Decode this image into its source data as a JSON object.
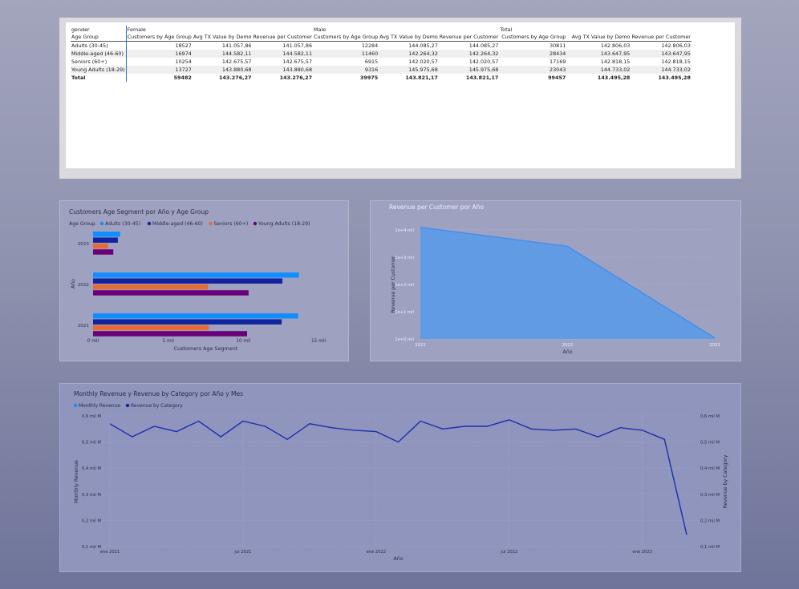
{
  "table": {
    "header_row1": {
      "col_label": "gender",
      "female": "Female",
      "male": "Male",
      "total": "Total"
    },
    "header_row2": {
      "row_label": "Age Group",
      "c1": "Customers by Age Group",
      "c2": "Avg TX Value by Demo",
      "c3": "Revenue per Customer",
      "c4": "Customers by Age Group",
      "c5": "Avg TX Value by Demo",
      "c6": "Revenue per Customer",
      "c7": "Customers by Age Group",
      "c8": "Avg TX Value by Demo",
      "c9": "Revenue per Customer"
    },
    "rows": [
      {
        "group": "Adults (30-45)",
        "v": [
          "18527",
          "141.057,86",
          "141.057,86",
          "12284",
          "144.085,27",
          "144.085,27",
          "30811",
          "142.806,03",
          "142.806,03"
        ]
      },
      {
        "group": "Middle-aged (46-60)",
        "v": [
          "16974",
          "144.582,11",
          "144.582,11",
          "11460",
          "142.264,32",
          "142.264,32",
          "28434",
          "143.647,95",
          "143.647,95"
        ]
      },
      {
        "group": "Seniors (60+)",
        "v": [
          "10254",
          "142.675,57",
          "142.675,57",
          "6915",
          "142.020,57",
          "142.020,57",
          "17169",
          "142.818,15",
          "142.818,15"
        ]
      },
      {
        "group": "Young Adults (18-29)",
        "v": [
          "13727",
          "143.880,68",
          "143.880,68",
          "9316",
          "145.975,68",
          "145.975,68",
          "23043",
          "144.733,02",
          "144.733,02"
        ]
      }
    ],
    "total": {
      "group": "Total",
      "v": [
        "59482",
        "143.276,27",
        "143.276,27",
        "39975",
        "143.821,17",
        "143.821,17",
        "99457",
        "143.495,28",
        "143.495,28"
      ]
    }
  },
  "bar_chart": {
    "title": "Customers Age Segment por Año y Age Group",
    "legend_title": "Age Group",
    "xlabel": "Customers Age Segment",
    "ylabel": "Año",
    "xticks": [
      "0 mil",
      "5 mil",
      "10 mil",
      "15 mil"
    ],
    "colors": {
      "adults": "#118dff",
      "middle": "#12239e",
      "seniors": "#e66c37",
      "young": "#6b007b"
    }
  },
  "area_chart": {
    "title": "Revenue per Customer por Año",
    "xlabel": "Año",
    "ylabel": "Revenue per Customer",
    "yticks": [
      "1e+4 mil",
      "1e+3 mil",
      "1e+2 mil",
      "1e+1 mil",
      "1e+0 mil"
    ],
    "xticks": [
      "2021",
      "2022",
      "2023"
    ],
    "color": "#5a9ae8"
  },
  "line_chart": {
    "title": "Monthly Revenue y Revenue by Category por Año y Mes",
    "legend": [
      "Monthly Revenue",
      "Revenue by Category"
    ],
    "xlabel": "Año",
    "ylabel_left": "Monthly Revenue",
    "ylabel_right": "Revenue by Category",
    "yticks_left": [
      "0,6 mil M",
      "0,5 mil M",
      "0,4 mil M",
      "0,3 mil M",
      "0,2 mil M",
      "0,1 mil M"
    ],
    "yticks_right": [
      "0,6 mil M",
      "0,5 mil M",
      "0,4 mil M",
      "0,3 mil M",
      "0,2 mil M",
      "0,1 mil M"
    ],
    "xticks": [
      "ene 2021",
      "jul 2021",
      "ene 2022",
      "jul 2022",
      "ene 2023"
    ],
    "legend_colors": [
      "#118dff",
      "#12239e"
    ],
    "line_color": "#1a2fb0"
  },
  "chart_data": [
    {
      "type": "bar",
      "orientation": "horizontal",
      "title": "Customers Age Segment por Año y Age Group",
      "xlabel": "Customers Age Segment",
      "ylabel": "Año",
      "categories": [
        "2023",
        "2022",
        "2021"
      ],
      "xlim": [
        0,
        15000
      ],
      "legend_position": "top-left",
      "series": [
        {
          "name": "Adults (30-45)",
          "values": [
            1800,
            13700,
            13650
          ]
        },
        {
          "name": "Middle-aged (46-60)",
          "values": [
            1650,
            12600,
            12550
          ]
        },
        {
          "name": "Seniors (60+)",
          "values": [
            1000,
            7650,
            7700
          ]
        },
        {
          "name": "Young Adults (18-29)",
          "values": [
            1350,
            10350,
            10250
          ]
        }
      ]
    },
    {
      "type": "area",
      "title": "Revenue per Customer por Año",
      "xlabel": "Año",
      "ylabel": "Revenue per Customer",
      "x": [
        "2021",
        "2022",
        "2023"
      ],
      "y_scale": "log",
      "ylim": [
        1,
        10000
      ],
      "values": [
        12500,
        2500,
        1.1
      ]
    },
    {
      "type": "line",
      "title": "Monthly Revenue y Revenue by Category por Año y Mes",
      "xlabel": "Año",
      "x": [
        "ene 2021",
        "feb 2021",
        "mar 2021",
        "abr 2021",
        "may 2021",
        "jun 2021",
        "jul 2021",
        "ago 2021",
        "sep 2021",
        "oct 2021",
        "nov 2021",
        "dic 2021",
        "ene 2022",
        "feb 2022",
        "mar 2022",
        "abr 2022",
        "may 2022",
        "jun 2022",
        "jul 2022",
        "ago 2022",
        "sep 2022",
        "oct 2022",
        "nov 2022",
        "dic 2022",
        "ene 2023",
        "feb 2023",
        "mar 2023"
      ],
      "ylim": [
        0.1,
        0.6
      ],
      "y_unit": "mil M",
      "series": [
        {
          "name": "Monthly Revenue",
          "values": [
            0.57,
            0.52,
            0.56,
            0.54,
            0.58,
            0.52,
            0.58,
            0.56,
            0.51,
            0.57,
            0.555,
            0.545,
            0.54,
            0.5,
            0.58,
            0.55,
            0.56,
            0.56,
            0.585,
            0.55,
            0.545,
            0.55,
            0.52,
            0.555,
            0.545,
            0.51,
            0.145
          ]
        }
      ]
    }
  ]
}
